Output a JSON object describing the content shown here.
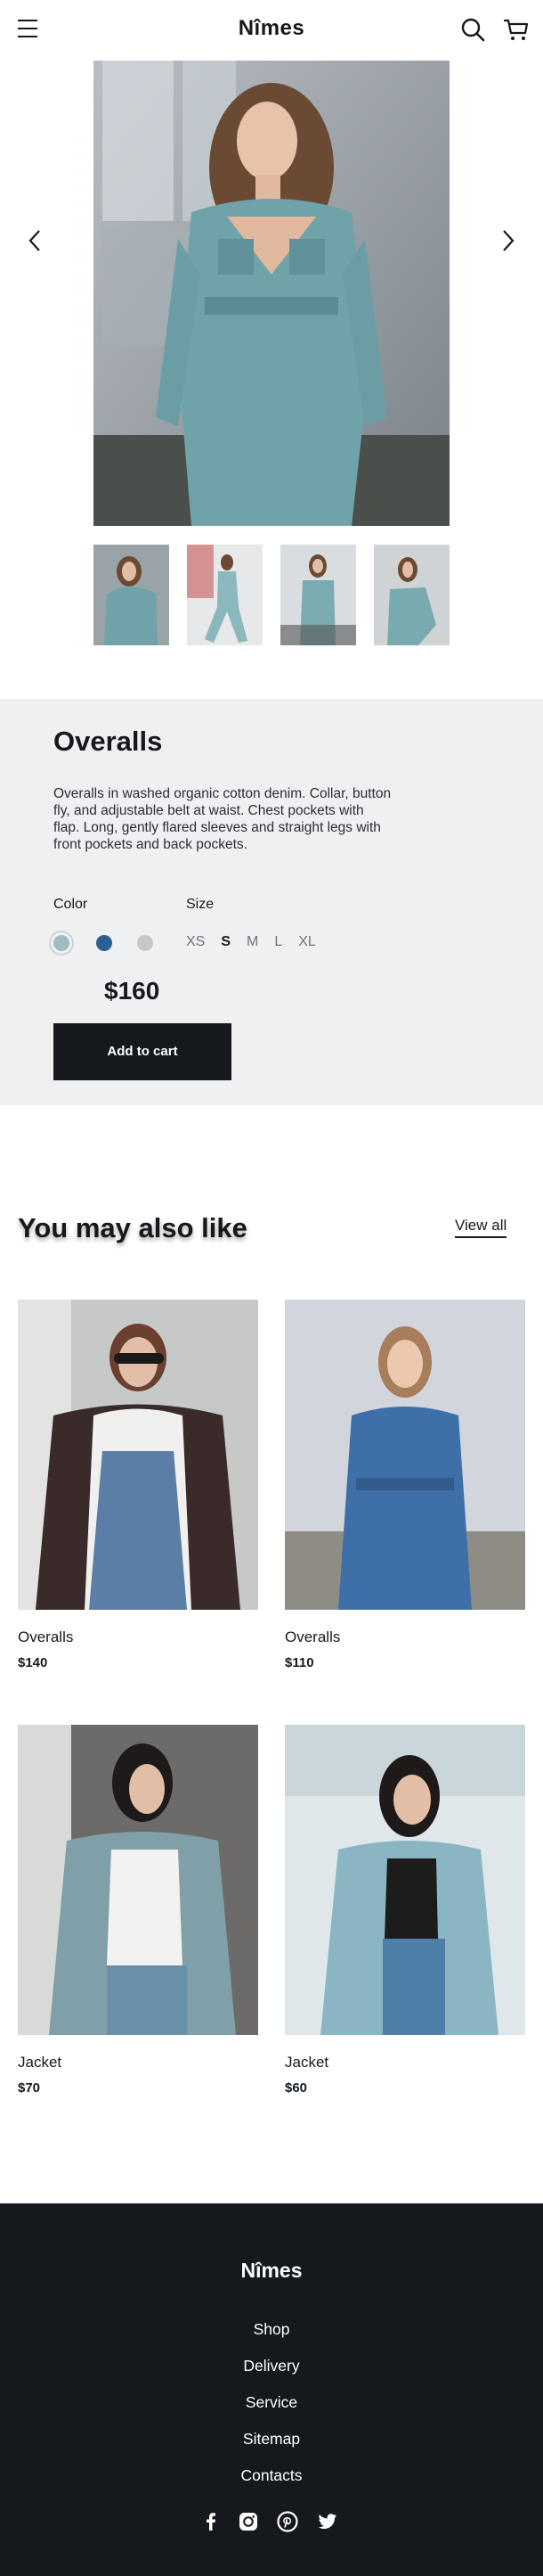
{
  "header": {
    "logo": "Nîmes",
    "menu_icon": "hamburger-icon",
    "search_icon": "search-icon",
    "cart_icon": "cart-icon"
  },
  "gallery": {
    "prev_icon": "chevron-left-icon",
    "next_icon": "chevron-right-icon",
    "thumbnail_count": 4
  },
  "product": {
    "title": "Overalls",
    "description": "Overalls in washed organic cotton denim. Collar, button fly, and adjustable belt at waist. Chest pockets with flap. Long, gently flared sleeves and straight legs with front pockets and back pockets.",
    "color_label": "Color",
    "size_label": "Size",
    "colors": [
      "#9fbcc0",
      "#2f5e93",
      "#c6c9cc"
    ],
    "selected_color_index": 0,
    "sizes": [
      "XS",
      "S",
      "M",
      "L",
      "XL"
    ],
    "selected_size": "S",
    "price": "$160",
    "add_to_cart": "Add to cart"
  },
  "related": {
    "title": "You may also like",
    "view_all": "View all",
    "items": [
      {
        "name": "Overalls",
        "price": "$140"
      },
      {
        "name": "Overalls",
        "price": "$110"
      },
      {
        "name": "Jacket",
        "price": "$70"
      },
      {
        "name": "Jacket",
        "price": "$60"
      }
    ]
  },
  "footer": {
    "logo": "Nîmes",
    "links": [
      "Shop",
      "Delivery",
      "Service",
      "Sitemap",
      "Contacts"
    ],
    "social": [
      "facebook-icon",
      "instagram-icon",
      "pinterest-icon",
      "twitter-icon"
    ]
  }
}
